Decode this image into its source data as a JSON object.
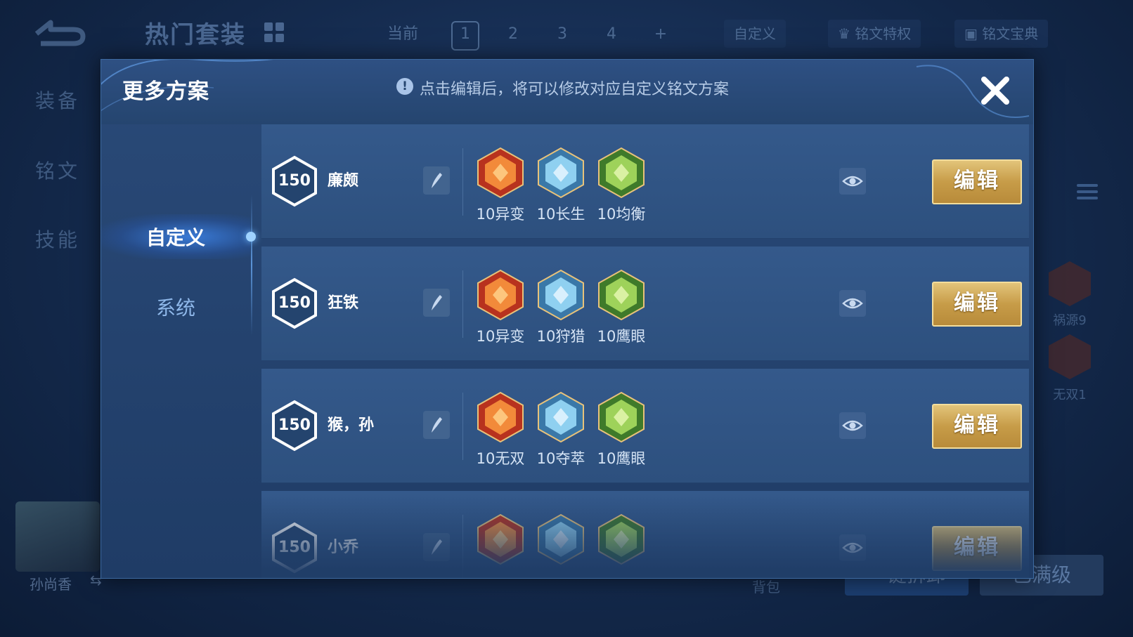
{
  "background": {
    "title": "热门套装",
    "tabs": [
      "当前",
      "1",
      "2",
      "3",
      "4",
      "+"
    ],
    "custom_label": "自定义",
    "rune_privilege_label": "铭文特权",
    "rune_codex_label": "铭文宝典",
    "side_nav": [
      "装备",
      "铭文",
      "技能"
    ],
    "hero_name": "孙尚香",
    "bag_label": "背包",
    "action_label_1": "一键拆卸",
    "action_label_2": "已满级",
    "rune_labels": [
      "祸源9",
      "无双1"
    ]
  },
  "modal": {
    "title": "更多方案",
    "hint": "点击编辑后，将可以修改对应自定义铭文方案",
    "nav": {
      "custom": "自定义",
      "system": "系统"
    },
    "edit_label": "编辑",
    "plans": [
      {
        "level": "150",
        "name": "廉颇",
        "runes": [
          {
            "label": "10异变",
            "color": "red"
          },
          {
            "label": "10长生",
            "color": "blue"
          },
          {
            "label": "10均衡",
            "color": "green"
          }
        ]
      },
      {
        "level": "150",
        "name": "狂铁",
        "runes": [
          {
            "label": "10异变",
            "color": "red"
          },
          {
            "label": "10狩猎",
            "color": "blue"
          },
          {
            "label": "10鹰眼",
            "color": "green"
          }
        ]
      },
      {
        "level": "150",
        "name": "猴，孙",
        "runes": [
          {
            "label": "10无双",
            "color": "red"
          },
          {
            "label": "10夺萃",
            "color": "blue"
          },
          {
            "label": "10鹰眼",
            "color": "green"
          }
        ]
      },
      {
        "level": "150",
        "name": "小乔",
        "runes": [
          {
            "label": "",
            "color": "red"
          },
          {
            "label": "",
            "color": "blue"
          },
          {
            "label": "",
            "color": "green"
          }
        ]
      }
    ]
  },
  "colors": {
    "gold": "#c79c48",
    "modal_bg": "#1f3c66",
    "accent_blue": "#6fb8ff"
  }
}
